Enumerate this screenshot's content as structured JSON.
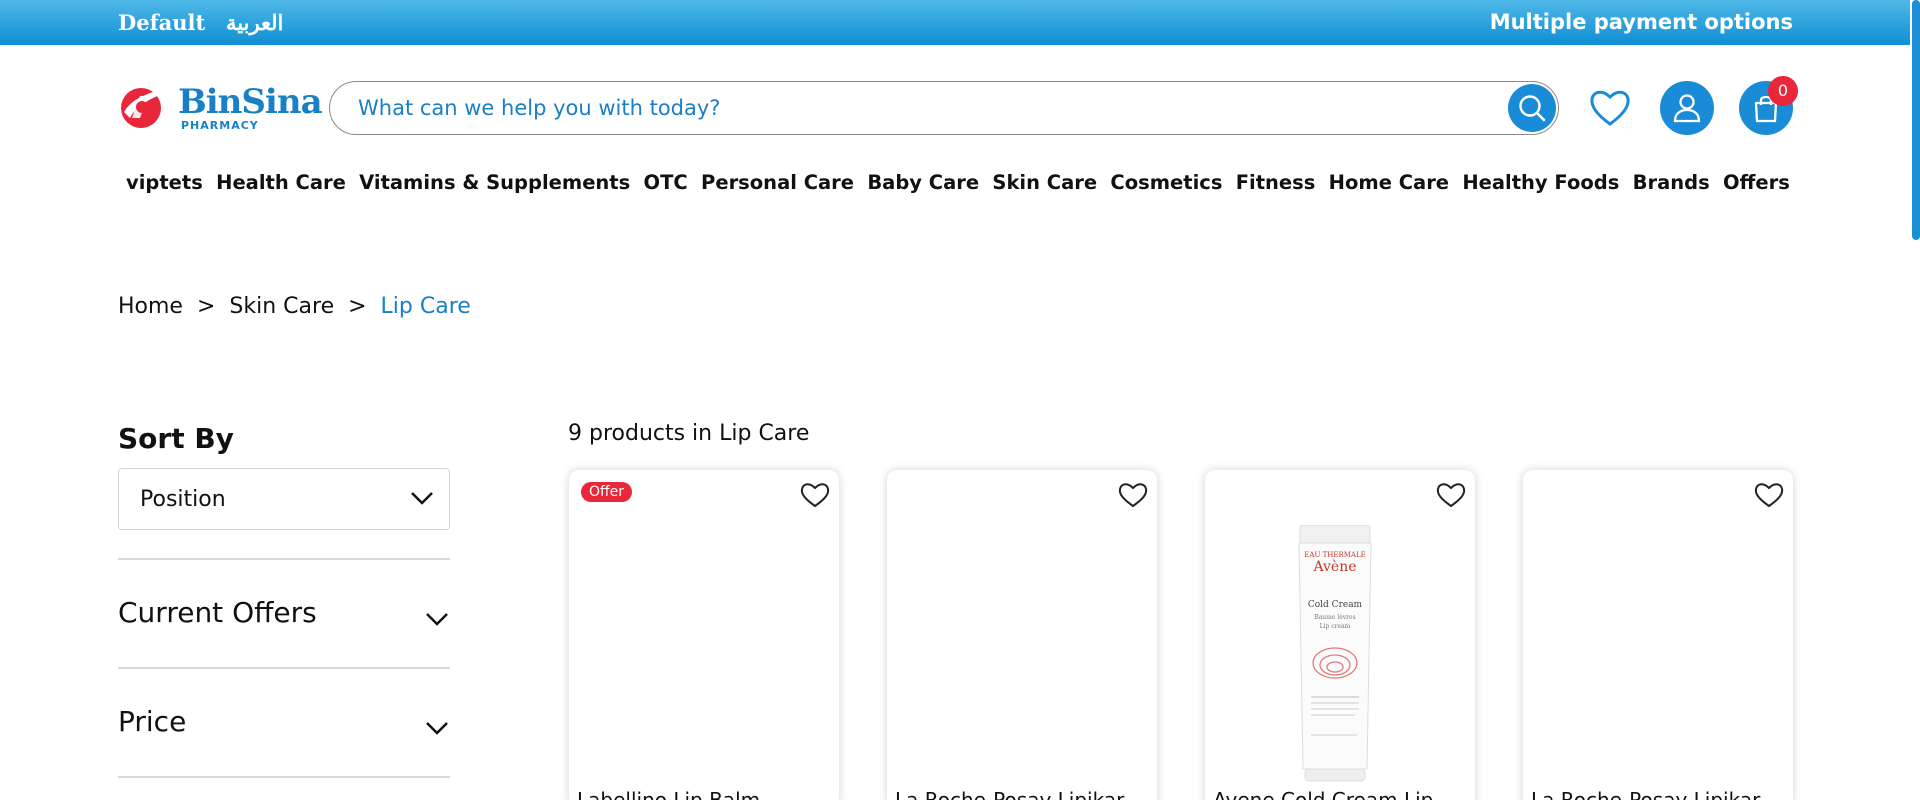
{
  "topbar": {
    "lang_default": "Default",
    "lang_arabic": "العربية",
    "payment": "Multiple payment options"
  },
  "header": {
    "logo_name": "BinSina",
    "logo_sub": "PHARMACY",
    "search_placeholder": "What can we help you with today?",
    "cart_count": "0"
  },
  "nav": {
    "items": [
      "viptets",
      "Health Care",
      "Vitamins & Supplements",
      "OTC",
      "Personal Care",
      "Baby Care",
      "Skin Care",
      "Cosmetics",
      "Fitness",
      "Home Care",
      "Healthy Foods",
      "Brands",
      "Offers"
    ]
  },
  "breadcrumb": {
    "home": "Home",
    "sep": ">",
    "category": "Skin Care",
    "current": "Lip Care"
  },
  "sidebar": {
    "sort_title": "Sort By",
    "sort_value": "Position",
    "filters": [
      "Current Offers",
      "Price"
    ]
  },
  "products": {
    "count_text": "9 products in Lip Care",
    "offer_badge": "Offer",
    "items": [
      {
        "title": "Labellino Lip Balm",
        "offer": true
      },
      {
        "title": "La Roche-Posay Lipikar",
        "offer": false
      },
      {
        "title": "Avene Cold Cream Lip",
        "offer": false
      },
      {
        "title": "La Roche-Posay Lipikar",
        "offer": false
      }
    ],
    "tube": {
      "brand_small": "EAU THERMALE",
      "brand": "Avène",
      "name": "Cold Cream",
      "sub1": "Baume lèvres",
      "sub2": "Lip cream"
    }
  },
  "colors": {
    "brand_blue": "#1a8bd6",
    "badge_red": "#e8273a",
    "topbar_top": "#4fb8e8",
    "topbar_bottom": "#0f8fd3"
  },
  "icons": {
    "search": "search-icon",
    "wishlist": "heart-icon",
    "account": "user-icon",
    "cart": "bag-icon",
    "dropdown": "chevron-down-icon"
  }
}
